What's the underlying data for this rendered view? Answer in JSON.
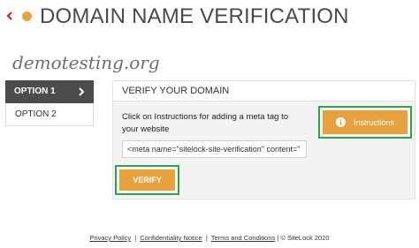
{
  "header": {
    "title": "DOMAIN NAME VERIFICATION",
    "back_icon": "chevron-left-icon",
    "accent": "#e8a23d",
    "back_color": "#b5322a"
  },
  "domain": "demotesting.org",
  "sidebar": {
    "items": [
      {
        "label": "OPTION 1",
        "active": true
      },
      {
        "label": "OPTION 2",
        "active": false
      }
    ]
  },
  "panel": {
    "title": "VERIFY YOUR DOMAIN",
    "description": "Click on Instructions for adding a meta tag to your website",
    "meta_value": "<meta name=\"sitelock-site-verification\" content=\"",
    "instructions_label": "Instructions",
    "verify_label": "VERIFY",
    "button_color": "#e8a23d",
    "highlight_color": "#2ea44f"
  },
  "footer": {
    "privacy": "Privacy Policy",
    "sep1": "|",
    "confidentiality": "Confidentiality Notice",
    "sep2": "|",
    "terms": "Terms and Conditions",
    "copyright": "| © SiteLock 2020"
  }
}
